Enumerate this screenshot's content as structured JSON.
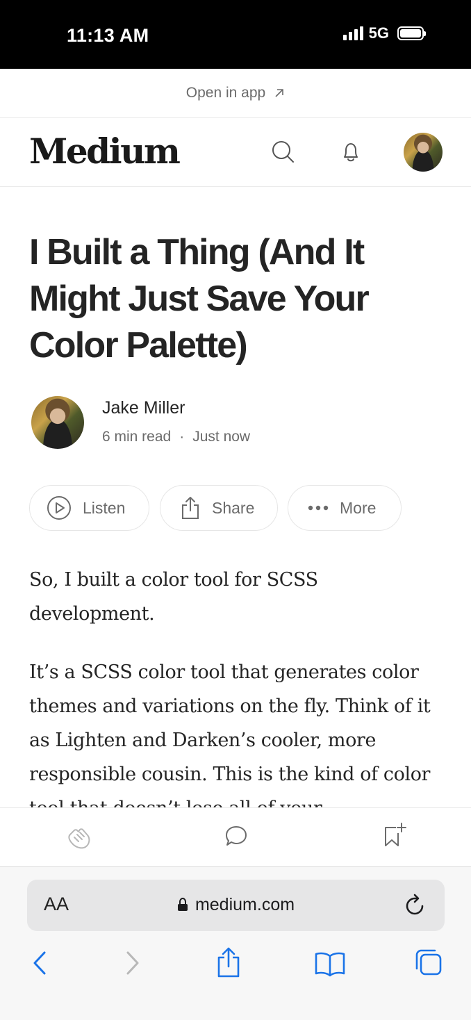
{
  "status_bar": {
    "time": "11:13 AM",
    "network": "5G"
  },
  "banner": {
    "open_in_app": "Open in app"
  },
  "header": {
    "logo": "Medium"
  },
  "article": {
    "title": "I Built a Thing (And It Might Just Save Your Color Palette)",
    "author": "Jake Miller",
    "read_time": "6 min read",
    "separator": "·",
    "published": "Just now",
    "actions": {
      "listen": "Listen",
      "share": "Share",
      "more": "More"
    },
    "paragraphs": [
      "So, I built a color tool for SCSS development.",
      "It’s a SCSS color tool that generates color themes and variations on the fly. Think of it as Lighten and Darken’s cooler, more responsible cousin. This is the kind of color tool that doesn’t lose all of your"
    ]
  },
  "browser": {
    "text_size": "AA",
    "url": "medium.com"
  },
  "colors": {
    "ios_blue": "#1a73e8",
    "text": "#242424",
    "muted": "#6b6b6b"
  }
}
